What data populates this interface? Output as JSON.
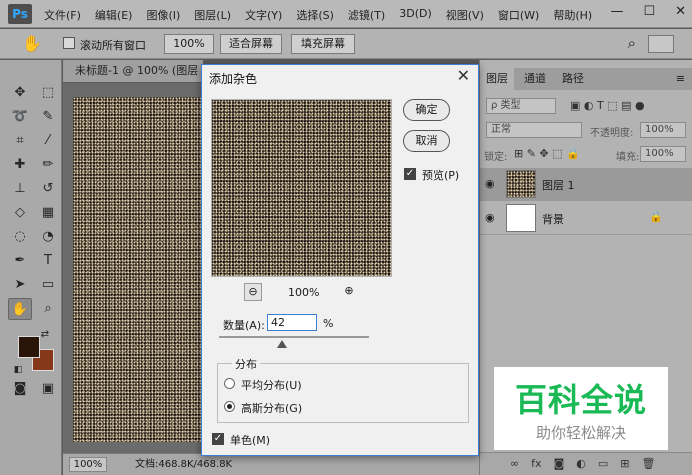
{
  "app": {
    "logo": "Ps"
  },
  "menubar": {
    "items": [
      "文件(F)",
      "编辑(E)",
      "图像(I)",
      "图层(L)",
      "文字(Y)",
      "选择(S)",
      "滤镜(T)",
      "3D(D)",
      "视图(V)",
      "窗口(W)",
      "帮助(H)"
    ],
    "minimize": "—",
    "restore": "☐",
    "close": "✕"
  },
  "options": {
    "scroll_all_label": "滚动所有窗口",
    "zoom_value": "100%",
    "fit_screen": "适合屏幕",
    "fill_screen": "填充屏幕"
  },
  "document": {
    "tab_title": "未标题-1 @ 100% (图层",
    "zoom": "100%",
    "doc_size": "文档:468.8K/468.8K"
  },
  "dialog": {
    "title": "添加杂色",
    "ok": "确定",
    "cancel": "取消",
    "preview_label": "预览(P)",
    "preview_zoom": "100%",
    "amount_label": "数量(A):",
    "amount_value": "42",
    "amount_unit": "%",
    "amount_fraction": 0.42,
    "distribution_label": "分布",
    "uniform_label": "平均分布(U)",
    "gaussian_label": "高斯分布(G)",
    "monochromatic_label": "单色(M)",
    "selected_distribution": "gaussian",
    "preview_checked": true,
    "monochromatic_checked": true
  },
  "layers_panel": {
    "tabs": [
      "图层",
      "通道",
      "路径"
    ],
    "filter_kind": "ρ 类型",
    "blend_mode": "正常",
    "opacity_label": "不透明度:",
    "opacity_value": "100%",
    "lock_label": "锁定:",
    "fill_label": "填充:",
    "fill_value": "100%",
    "layers": [
      {
        "name": "图层 1",
        "selected": true
      },
      {
        "name": "背景",
        "locked": true
      }
    ]
  },
  "watermark": {
    "line1": "百科全说",
    "line2": "助你轻松解决"
  },
  "colors": {
    "foreground": "#2a1608",
    "background": "#85391a",
    "brand": "#19b955",
    "accent": "#3d7fd4"
  }
}
